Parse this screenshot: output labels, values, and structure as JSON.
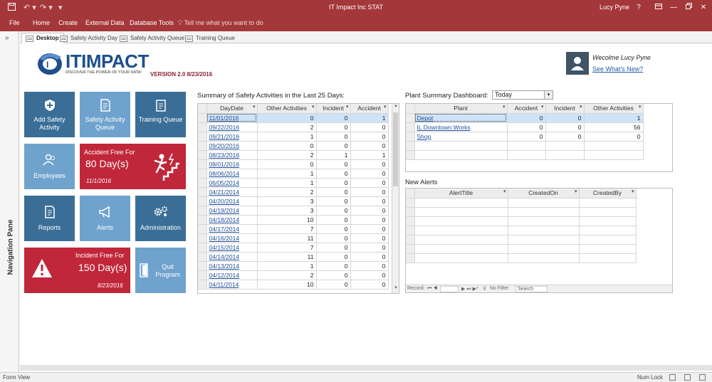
{
  "titlebar": {
    "app_title": "IT Impact Inc STAT",
    "user": "Lucy Pyne",
    "help": "?"
  },
  "ribbon": {
    "tabs": [
      "File",
      "Home",
      "Create",
      "External Data",
      "Database Tools"
    ],
    "tell_me": "Tell me what you want to do"
  },
  "nav_pane": {
    "label": "Navigation Pane",
    "collapse": "»"
  },
  "doc_tabs": [
    "Desktop",
    "Safety Activity Day",
    "Safety Activity Queue",
    "Training Queue"
  ],
  "header": {
    "logo_brand": "ITIMPACT",
    "logo_tagline": "DISCOVER THE POWER OF YOUR DATA!",
    "version": "VERSION 2.0 8/23/2016",
    "welcome": "Wecolme Lucy Pyne",
    "whats_new": "See What's New?"
  },
  "tiles": {
    "add_safety": "Add Safety Activity",
    "safety_queue": "Safety Activity Queue",
    "training_queue": "Training Queue",
    "employees": "Employees",
    "reports": "Reports",
    "alerts": "Alerts",
    "administration": "Administration",
    "quit": "Quit Program",
    "accident_title": "Accident Free For",
    "accident_days": "80 Day(s)",
    "accident_date": "11/1/2016",
    "incident_title": "Incident Free For",
    "incident_days": "150 Day(s)",
    "incident_date": "8/23/2016"
  },
  "summary": {
    "title": "Summary of Safety Activities in the Last 25 Days:",
    "columns": [
      "DayDate",
      "Other Activities",
      "Incident",
      "Accident"
    ],
    "rows": [
      [
        "11/01/2016",
        "0",
        "0",
        "1"
      ],
      [
        "09/22/2016",
        "2",
        "0",
        "0"
      ],
      [
        "09/21/2016",
        "1",
        "0",
        "0"
      ],
      [
        "09/20/2016",
        "0",
        "0",
        "0"
      ],
      [
        "08/23/2016",
        "2",
        "1",
        "1"
      ],
      [
        "08/01/2016",
        "0",
        "0",
        "0"
      ],
      [
        "08/06/2014",
        "1",
        "0",
        "0"
      ],
      [
        "06/05/2014",
        "1",
        "0",
        "0"
      ],
      [
        "04/21/2014",
        "2",
        "0",
        "0"
      ],
      [
        "04/20/2014",
        "3",
        "0",
        "0"
      ],
      [
        "04/19/2014",
        "3",
        "0",
        "0"
      ],
      [
        "04/18/2014",
        "10",
        "0",
        "0"
      ],
      [
        "04/17/2014",
        "7",
        "0",
        "0"
      ],
      [
        "04/16/2014",
        "11",
        "0",
        "0"
      ],
      [
        "04/15/2014",
        "7",
        "0",
        "0"
      ],
      [
        "04/14/2014",
        "11",
        "0",
        "0"
      ],
      [
        "04/13/2014",
        "1",
        "0",
        "0"
      ],
      [
        "04/12/2014",
        "2",
        "0",
        "0"
      ],
      [
        "04/11/2014",
        "10",
        "0",
        "0"
      ]
    ]
  },
  "plant": {
    "title": "Plant Summary Dashboard:",
    "filter_value": "Today",
    "columns": [
      "Plant",
      "Accident",
      "Incident",
      "Other Activities"
    ],
    "rows": [
      [
        "Depot",
        "0",
        "0",
        "1"
      ],
      [
        "IL Downtown Works",
        "0",
        "0",
        "56"
      ],
      [
        "Shop",
        "0",
        "0",
        "0"
      ]
    ]
  },
  "alerts": {
    "title": "New Alerts",
    "columns": [
      "AlertTitle",
      "CreatedOn",
      "CreatedBy"
    ],
    "nav_record": "Record:",
    "nav_nofilter": "No Filter",
    "nav_search": "Search"
  },
  "status": {
    "left": "Form View",
    "right": "Num Lock"
  },
  "colors": {
    "accent": "#a4373a",
    "tile_dark": "#3a6e97",
    "tile_light": "#6fa3cd",
    "tile_red": "#c0273a"
  }
}
